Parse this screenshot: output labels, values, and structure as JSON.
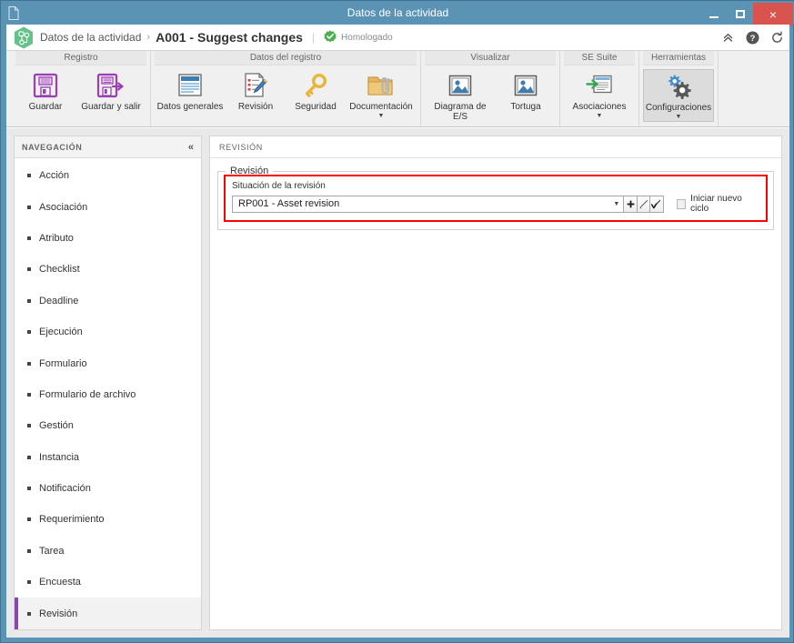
{
  "window": {
    "title": "Datos de la actividad",
    "doc_icon": "document-icon",
    "minimize_label": "Minimizar",
    "maximize_label": "Maximizar",
    "close_label": "×"
  },
  "header": {
    "logo_icon": "app-hexagon-logo",
    "breadcrumb_root": "Datos de la actividad",
    "breadcrumb_separator": "›",
    "breadcrumb_current": "A001 - Suggest changes",
    "divider": "|",
    "status_badge_icon": "verified-badge-icon",
    "status_badge_label": "Homologado",
    "actions": [
      {
        "name": "collapse-ribbon-icon",
        "glyph": "«"
      },
      {
        "name": "help-icon",
        "glyph": "?"
      },
      {
        "name": "refresh-icon",
        "glyph": "↻"
      }
    ]
  },
  "ribbon": {
    "groups": [
      {
        "title": "Registro",
        "items": [
          {
            "label": "Guardar",
            "icon": "save-floppy-icon",
            "caret": false,
            "active": false,
            "wide": false
          },
          {
            "label": "Guardar y salir",
            "icon": "save-and-exit-floppy-icon",
            "caret": false,
            "active": false,
            "wide": true
          }
        ]
      },
      {
        "title": "Datos del registro",
        "items": [
          {
            "label": "Datos generales",
            "icon": "general-data-window-icon",
            "caret": false,
            "active": false,
            "wide": true
          },
          {
            "label": "Revisión",
            "icon": "revision-checklist-pencil-icon",
            "caret": false,
            "active": false,
            "wide": false
          },
          {
            "label": "Seguridad",
            "icon": "security-key-icon",
            "caret": false,
            "active": false,
            "wide": false
          },
          {
            "label": "Documentación",
            "icon": "documentation-folder-clip-icon",
            "caret": true,
            "active": false,
            "wide": true
          }
        ]
      },
      {
        "title": "Visualizar",
        "items": [
          {
            "label": "Diagrama de E/S",
            "icon": "image-diagram-icon",
            "caret": false,
            "active": false,
            "wide": true
          },
          {
            "label": "Tortuga",
            "icon": "image-turtle-icon",
            "caret": false,
            "active": false,
            "wide": false
          }
        ]
      },
      {
        "title": "SE Suite",
        "items": [
          {
            "label": "Asociaciones",
            "icon": "associations-window-arrow-icon",
            "caret": true,
            "active": false,
            "wide": true
          }
        ]
      },
      {
        "title": "Herramientas",
        "items": [
          {
            "label": "Configuraciones",
            "icon": "settings-gears-icon",
            "caret": true,
            "active": true,
            "wide": true
          }
        ]
      }
    ]
  },
  "sidebar": {
    "title": "NAVEGACIÓN",
    "collapse_glyph": "«",
    "items": [
      {
        "label": "Acción",
        "selected": false
      },
      {
        "label": "Asociación",
        "selected": false
      },
      {
        "label": "Atributo",
        "selected": false
      },
      {
        "label": "Checklist",
        "selected": false
      },
      {
        "label": "Deadline",
        "selected": false
      },
      {
        "label": "Ejecución",
        "selected": false
      },
      {
        "label": "Formulario",
        "selected": false
      },
      {
        "label": "Formulario de archivo",
        "selected": false
      },
      {
        "label": "Gestión",
        "selected": false
      },
      {
        "label": "Instancia",
        "selected": false
      },
      {
        "label": "Notificación",
        "selected": false
      },
      {
        "label": "Requerimiento",
        "selected": false
      },
      {
        "label": "Tarea",
        "selected": false
      },
      {
        "label": "Encuesta",
        "selected": false
      },
      {
        "label": "Revisión",
        "selected": true
      }
    ]
  },
  "content": {
    "title": "REVISIÓN",
    "fieldset_legend": "Revisión",
    "field_label": "Situación de la revisión",
    "select_value": "RP001 - Asset revision",
    "select_caret": "▼",
    "mini_buttons": [
      {
        "name": "add-revision-button",
        "icon": "plus-icon",
        "glyph": "➕"
      },
      {
        "name": "edit-revision-button",
        "icon": "pencil-icon",
        "glyph": "✎"
      },
      {
        "name": "apply-revision-button",
        "icon": "pen-check-icon",
        "glyph": "✔"
      }
    ],
    "checkbox_label": "Iniciar nuevo ciclo",
    "checkbox_checked": false
  },
  "colors": {
    "titlebar": "#5b93b5",
    "close_button": "#d9534f",
    "accent_purple": "#8e44ad",
    "highlight_red": "#ff0000",
    "badge_green": "#4caf50",
    "ribbon_bg": "#f0f0f0"
  }
}
